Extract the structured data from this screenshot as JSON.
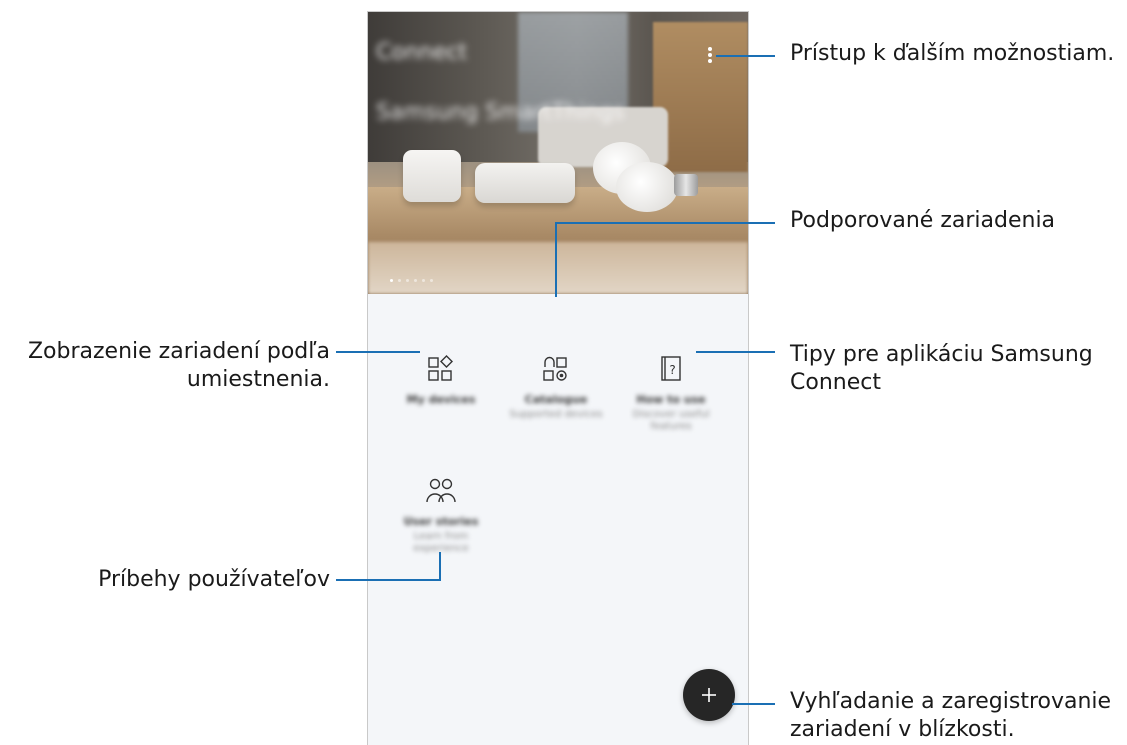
{
  "hero": {
    "title": "Connect",
    "subtitle": "Samsung SmartThings",
    "page_count": 6,
    "active_page": 0,
    "more_icon": "more-vertical-icon"
  },
  "tiles": [
    {
      "icon": "grid-diamond-icon",
      "label": "My devices",
      "sub": ""
    },
    {
      "icon": "catalogue-icon",
      "label": "Catalogue",
      "sub": "Supported devices"
    },
    {
      "icon": "help-book-icon",
      "label": "How to use",
      "sub": "Discover useful features"
    },
    {
      "icon": "users-icon",
      "label": "User stories",
      "sub": "Learn from experience"
    }
  ],
  "fab": {
    "icon": "plus-icon"
  },
  "annotations": {
    "more_options": "Prístup k ďalším možnostiam.",
    "supported": "Podporované zariadenia",
    "location_line1": "Zobrazenie zariadení podľa",
    "location_line2": "umiestnenia.",
    "tips_line1": "Tipy pre aplikáciu Samsung",
    "tips_line2": "Connect",
    "stories": "Príbehy používateľov",
    "search_line1": "Vyhľadanie a zaregistrovanie",
    "search_line2": "zariadení v blízkosti."
  },
  "colors": {
    "accent": "#1a6fb4",
    "fab": "#262626",
    "panel": "#f4f6f9"
  }
}
